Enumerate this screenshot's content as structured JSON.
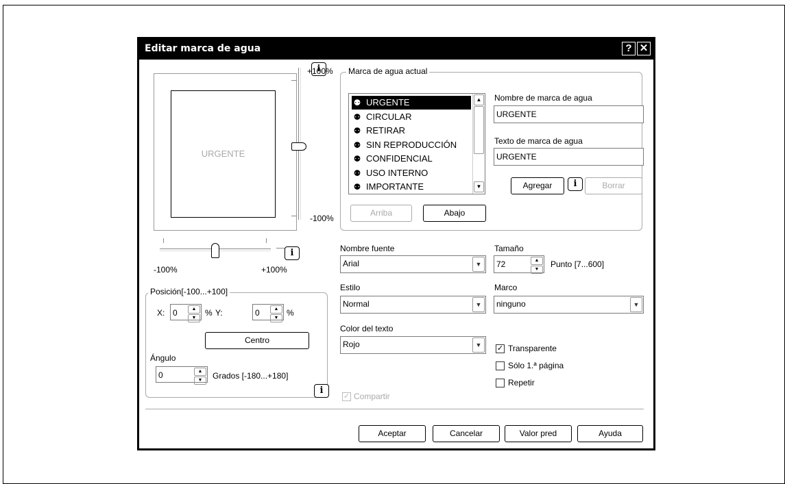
{
  "dialog": {
    "title": "Editar marca de agua",
    "help_btn": "?",
    "close_btn": "✕"
  },
  "preview": {
    "text": "URGENTE",
    "vslider_top": "+100%",
    "vslider_bottom": "-100%",
    "hslider_left": "-100%",
    "hslider_right": "+100%",
    "vslider_level": 0.52,
    "hslider_level": 0.5
  },
  "position": {
    "legend": "Posición[-100...+100]",
    "x_label": "X:",
    "x_value": "0",
    "x_unit": "%",
    "y_label": "Y:",
    "y_value": "0",
    "y_unit": "%",
    "center_btn": "Centro",
    "angle_label": "Ángulo",
    "angle_value": "0",
    "angle_unit": "Grados [-180...+180]"
  },
  "current": {
    "legend": "Marca de agua actual",
    "items": [
      "URGENTE",
      "CIRCULAR",
      "RETIRAR",
      "SIN REPRODUCCIÓN",
      "CONFIDENCIAL",
      "USO INTERNO",
      "IMPORTANTE"
    ],
    "selected": 0,
    "up_btn": "Arriba",
    "down_btn": "Abajo",
    "name_label": "Nombre de marca de agua",
    "name_value": "URGENTE",
    "text_label": "Texto de marca de agua",
    "text_value": "URGENTE",
    "add_btn": "Agregar",
    "delete_btn": "Borrar"
  },
  "font": {
    "font_label": "Nombre fuente",
    "font_value": "Arial",
    "size_label": "Tamaño",
    "size_value": "72",
    "size_unit": "Punto [7...600]",
    "style_label": "Estilo",
    "style_value": "Normal",
    "frame_label": "Marco",
    "frame_value": "ninguno",
    "color_label": "Color del texto",
    "color_value": "Rojo"
  },
  "options": {
    "transparent": "Transparente",
    "transparent_checked": true,
    "first_page": "Sólo 1.ª página",
    "first_page_checked": false,
    "repeat": "Repetir",
    "repeat_checked": false,
    "share": "Compartir",
    "share_checked": true
  },
  "buttons": {
    "ok": "Aceptar",
    "cancel": "Cancelar",
    "default": "Valor pred",
    "help": "Ayuda"
  },
  "icons": {
    "info": "i",
    "check": "✓",
    "arrow_down": "▼",
    "arrow_up": "▲"
  }
}
